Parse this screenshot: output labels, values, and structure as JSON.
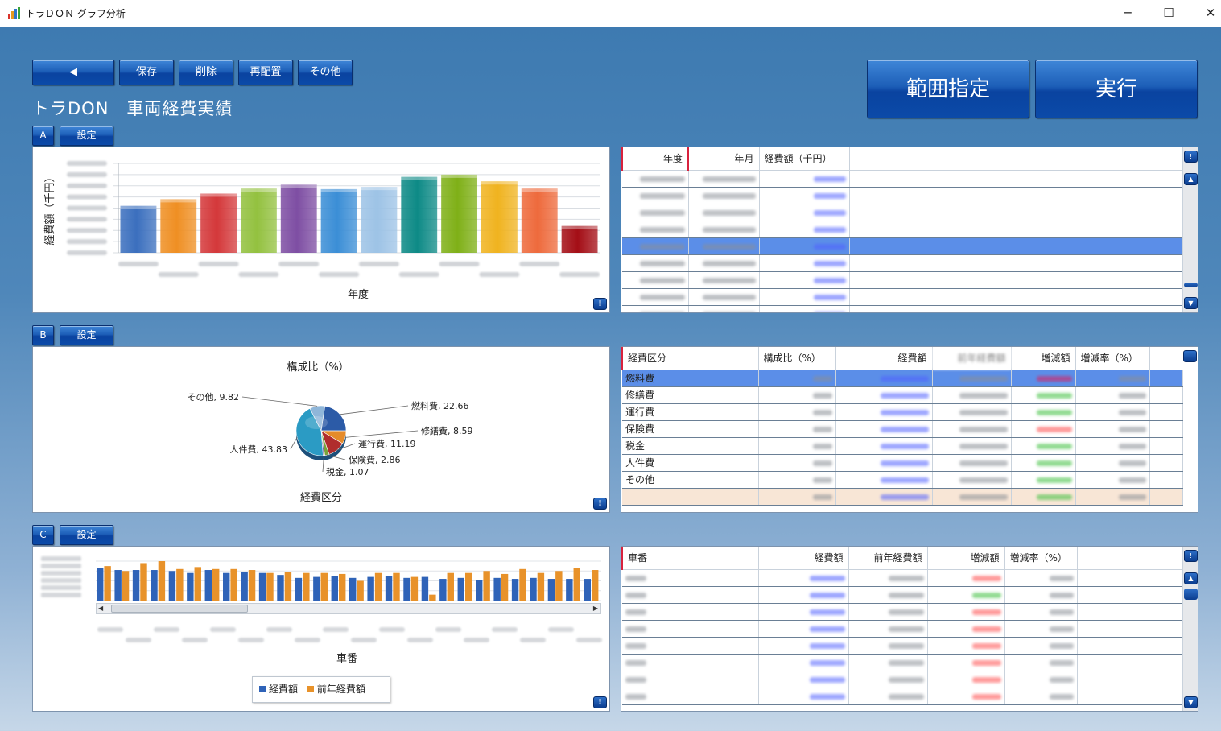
{
  "window": {
    "title": "トラＤＯＮ グラフ分析",
    "minimize": "─",
    "maximize": "☐",
    "close": "✕"
  },
  "toolbar": {
    "back_label": "◀",
    "save_label": "保存",
    "delete_label": "削除",
    "rearrange_label": "再配置",
    "other_label": "その他",
    "range_label": "範囲指定",
    "run_label": "実行"
  },
  "page_title": "トラDON　車両経費実績",
  "sections": {
    "a": {
      "tag": "A",
      "settings": "設定"
    },
    "b": {
      "tag": "B",
      "settings": "設定"
    },
    "c": {
      "tag": "C",
      "settings": "設定"
    }
  },
  "info_icon": "!",
  "table_a": {
    "headers": [
      "年度",
      "年月",
      "経費額（千円）"
    ],
    "row_count": 9,
    "selected_row": 4
  },
  "table_b": {
    "headers": [
      "経費区分",
      "構成比（%）",
      "経費額",
      "前年経費額",
      "増減額",
      "増減率（%）"
    ],
    "rows": [
      "燃料費",
      "修繕費",
      "運行費",
      "保険費",
      "税金",
      "人件費",
      "その他",
      ""
    ],
    "selected_row": 0
  },
  "table_c": {
    "headers": [
      "車番",
      "経費額",
      "前年経費額",
      "増減額",
      "増減率（%）"
    ],
    "row_count": 8
  },
  "colors": {
    "accent": "#1d5fb8",
    "selection": "#5b8ee8",
    "total_row": "#f8e6d6"
  },
  "chart_data": [
    {
      "type": "bar",
      "xlabel": "年度",
      "ylabel": "経費額（千円）",
      "series_colors": [
        "#3b6fbe",
        "#ef8f23",
        "#d4383a",
        "#93c13f",
        "#7e4ea3",
        "#3b8ed6",
        "#9dc3e6",
        "#0d8a86",
        "#7fb017",
        "#f0b31f",
        "#ee6a3c",
        "#a40e16"
      ],
      "values": [
        420000,
        480000,
        530000,
        575000,
        610000,
        570000,
        590000,
        680000,
        700000,
        640000,
        575000,
        240000
      ],
      "ylim": [
        0,
        800000
      ],
      "grid": true
    },
    {
      "type": "pie",
      "title": "構成比（%）",
      "xlabel": "経費区分",
      "labels": [
        "燃料費, 22.66",
        "修繕費, 8.59",
        "運行費, 11.19",
        "保険費, 2.86",
        "税金, 1.07",
        "人件費, 43.83",
        "その他, 9.82"
      ],
      "values": [
        22.66,
        8.59,
        11.19,
        2.86,
        1.07,
        43.83,
        9.82
      ],
      "colors": [
        "#2c5ba7",
        "#e58b2a",
        "#b02d2d",
        "#7aa33a",
        "#6a4796",
        "#2b9bc4",
        "#8fb6d9"
      ]
    },
    {
      "type": "bar",
      "xlabel": "車番",
      "legend": "bottom",
      "series": [
        {
          "name": "経費額",
          "color": "#2f63b8",
          "values": [
            0.66,
            0.62,
            0.62,
            0.62,
            0.6,
            0.56,
            0.62,
            0.56,
            0.58,
            0.56,
            0.52,
            0.46,
            0.48,
            0.5,
            0.46,
            0.48,
            0.5,
            0.46,
            0.48,
            0.44,
            0.46,
            0.42,
            0.46,
            0.44,
            0.46,
            0.44,
            0.44,
            0.44
          ]
        },
        {
          "name": "前年経費額",
          "color": "#e8922a",
          "values": [
            0.7,
            0.6,
            0.76,
            0.8,
            0.64,
            0.68,
            0.64,
            0.64,
            0.62,
            0.56,
            0.58,
            0.56,
            0.56,
            0.54,
            0.4,
            0.56,
            0.56,
            0.48,
            0.12,
            0.56,
            0.56,
            0.6,
            0.54,
            0.64,
            0.56,
            0.6,
            0.66,
            0.62
          ]
        }
      ],
      "legend_labels": [
        "経費額",
        "前年経費額"
      ]
    }
  ]
}
